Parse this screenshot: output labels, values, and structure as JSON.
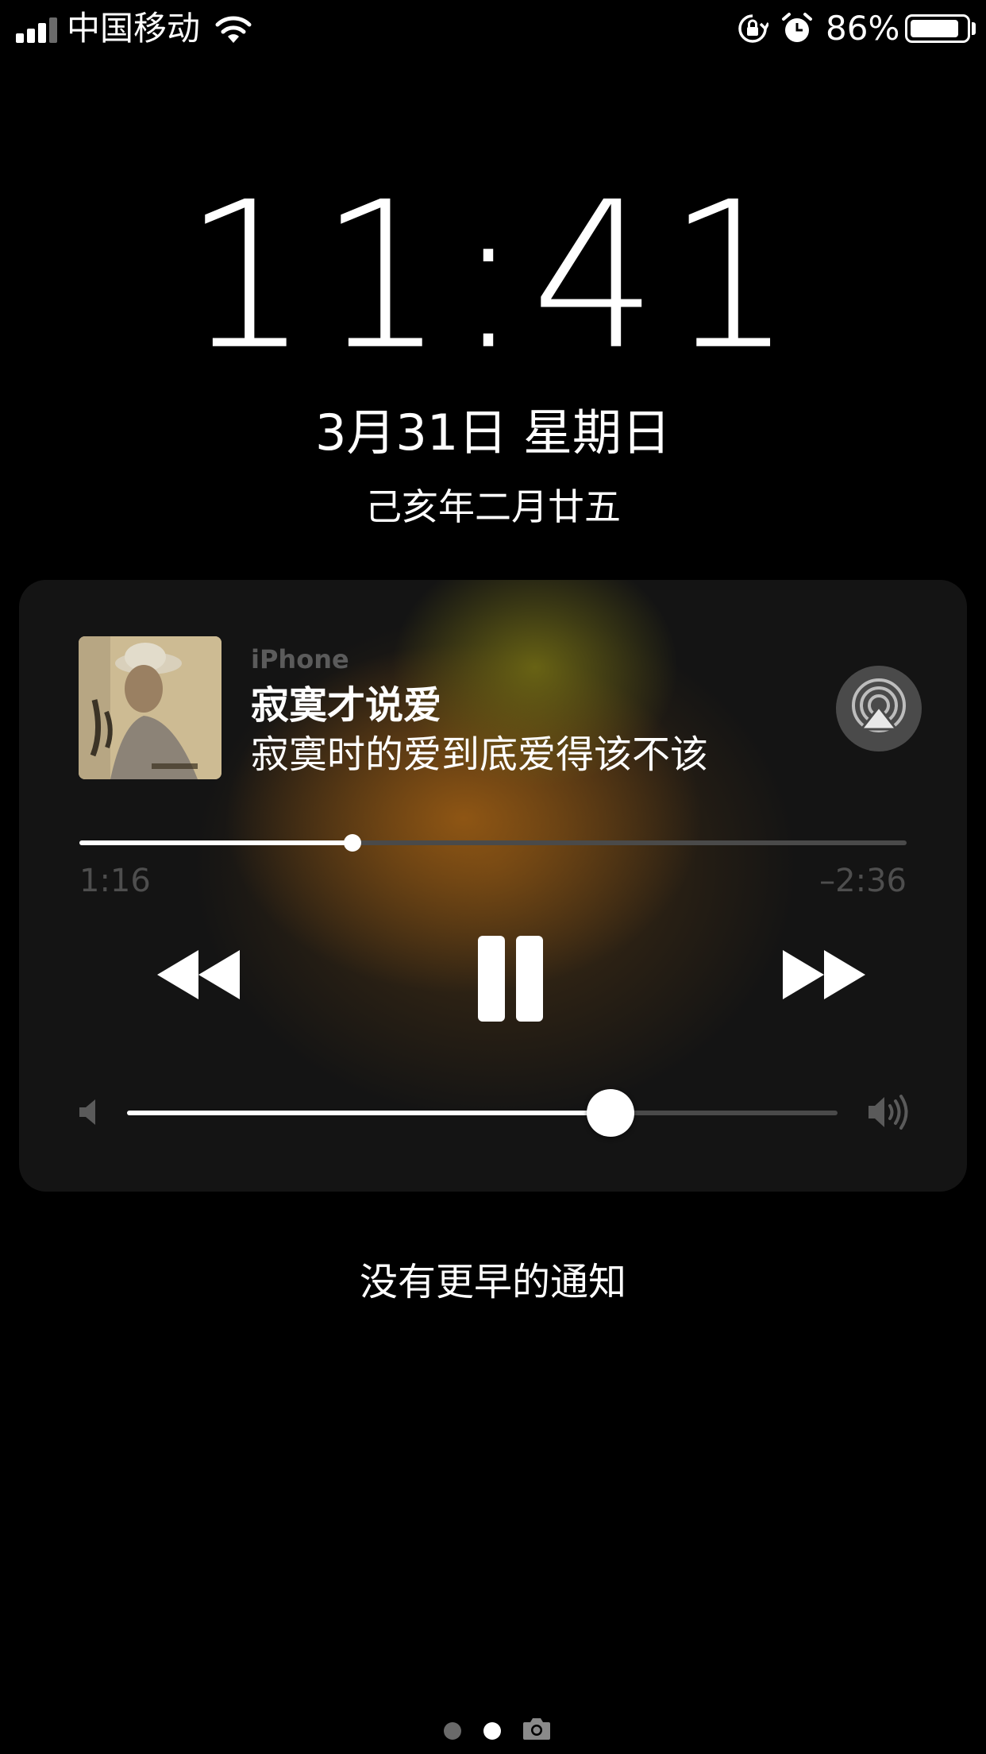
{
  "status_bar": {
    "carrier": "中国移动",
    "battery_percent": "86%",
    "battery_level": 0.86,
    "icons": [
      "signal-icon",
      "wifi-icon",
      "rotation-lock-icon",
      "alarm-icon",
      "battery-icon"
    ]
  },
  "lock_screen": {
    "time": "11:41",
    "date": "3月31日 星期日",
    "lunar_date": "己亥年二月廿五"
  },
  "now_playing": {
    "source": "iPhone",
    "title": "寂寞才说爱",
    "subtitle": "寂寞时的爱到底爱得该不该",
    "elapsed": "1:16",
    "remaining": "–2:36",
    "progress": 0.33,
    "volume": 0.68,
    "icons": [
      "album-art",
      "airplay-icon",
      "rewind-icon",
      "pause-icon",
      "forward-icon",
      "volume-low-icon",
      "volume-high-icon"
    ]
  },
  "notifications": {
    "empty_text": "没有更早的通知"
  },
  "page_indicator": {
    "pages": 3,
    "current": 1,
    "icons": [
      "camera-icon"
    ]
  }
}
